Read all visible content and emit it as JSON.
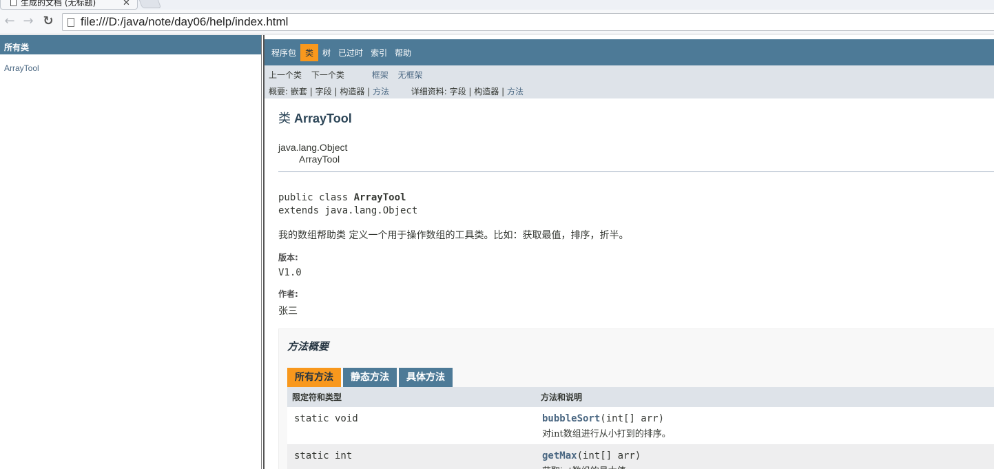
{
  "browser": {
    "tab_title": "生成的文档 (无标题)",
    "tab_close": "✕",
    "url": "file:///D:/java/note/day06/help/index.html",
    "back_glyph": "←",
    "forward_glyph": "→",
    "reload_glyph": "↻"
  },
  "left": {
    "header": "所有类",
    "items": [
      "ArrayTool"
    ]
  },
  "topnav": {
    "items": [
      "程序包",
      "类",
      "树",
      "已过时",
      "索引",
      "帮助"
    ],
    "active": "类"
  },
  "subnav": {
    "prev_class": "上一个类",
    "next_class": "下一个类",
    "frames": "框架",
    "no_frames": "无框架",
    "summary_label": "概要:",
    "summary_nested": "嵌套",
    "summary_field": "字段",
    "summary_constructor": "构造器",
    "summary_method": "方法",
    "detail_label": "详细资料:",
    "detail_field": "字段",
    "detail_constructor": "构造器",
    "detail_method": "方法",
    "sep": "|"
  },
  "class": {
    "kind": "类",
    "name": "ArrayTool",
    "parent": "java.lang.Object",
    "child": "ArrayTool",
    "sig_prefix": "public class ",
    "sig_extends": "extends java.lang.Object",
    "description": "我的数组帮助类 定义一个用于操作数组的工具类。比如：获取最值，排序，折半。",
    "version_label": "版本:",
    "version": "V1.0",
    "author_label": "作者:",
    "author": "张三"
  },
  "method_summary": {
    "title": "方法概要",
    "tabs": [
      "所有方法",
      "静态方法",
      "具体方法"
    ],
    "active_tab": "所有方法",
    "col_modifier": "限定符和类型",
    "col_method": "方法和说明",
    "rows": [
      {
        "modifier": "static void",
        "name": "bubbleSort",
        "params": "(int[] arr)",
        "desc": "对int数组进行从小打到的排序。"
      },
      {
        "modifier": "static int",
        "name": "getMax",
        "params": "(int[] arr)",
        "desc": "获取int数组的最大值。"
      }
    ]
  },
  "colors": {
    "nav_blue": "#4d7a97",
    "active_orange": "#f8981d",
    "subnav_gray": "#dee3e9",
    "link_blue": "#4a6782"
  }
}
